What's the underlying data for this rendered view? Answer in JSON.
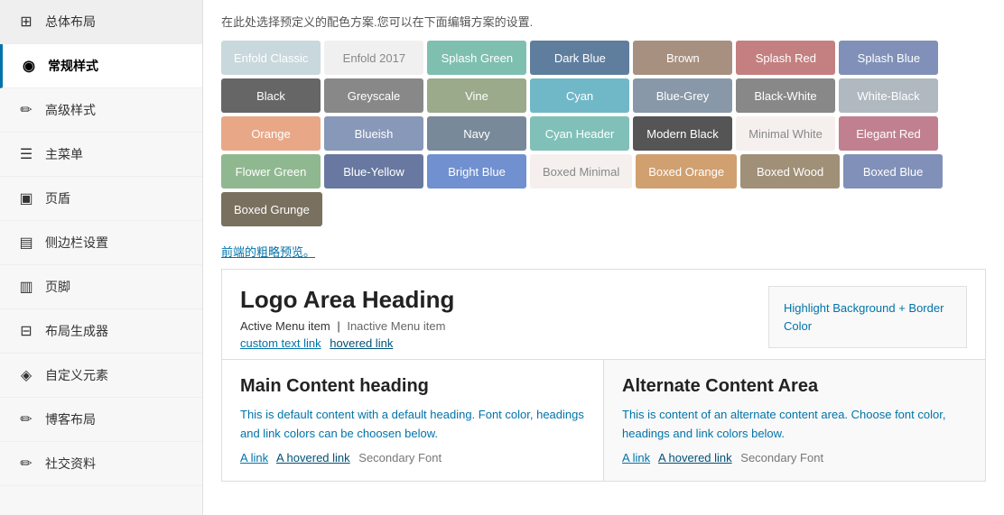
{
  "sidebar": {
    "items": [
      {
        "id": "general-layout",
        "label": "总体布局",
        "icon": "⊞",
        "active": false
      },
      {
        "id": "general-style",
        "label": "常规样式",
        "icon": "☺",
        "active": true
      },
      {
        "id": "advanced-style",
        "label": "高级样式",
        "icon": "✎",
        "active": false
      },
      {
        "id": "main-menu",
        "label": "主菜单",
        "icon": "☰",
        "active": false
      },
      {
        "id": "page-header",
        "label": "页盾",
        "icon": "▭",
        "active": false
      },
      {
        "id": "sidebar-settings",
        "label": "侧边栏设置",
        "icon": "▯",
        "active": false
      },
      {
        "id": "footer",
        "label": "页脚",
        "icon": "▭",
        "active": false
      },
      {
        "id": "layout-builder",
        "label": "布局生成器",
        "icon": "⊞",
        "active": false
      },
      {
        "id": "custom-elements",
        "label": "自定义元素",
        "icon": "✎",
        "active": false
      },
      {
        "id": "blog-layout",
        "label": "博客布局",
        "icon": "✎",
        "active": false
      },
      {
        "id": "contrib",
        "label": "社交资料",
        "icon": "☺",
        "active": false
      }
    ]
  },
  "main": {
    "instruction": "在此处选择预定义的配色方案.您可以在下面编辑方案的设置.",
    "color_schemes": [
      {
        "id": "enfold-classic",
        "label": "Enfold Classic",
        "bg": "#c9d8dd",
        "color": "#fff"
      },
      {
        "id": "enfold-2017",
        "label": "Enfold 2017",
        "bg": "#f0f0f0",
        "color": "#888"
      },
      {
        "id": "splash-green",
        "label": "Splash Green",
        "bg": "#7fbfb0",
        "color": "#fff"
      },
      {
        "id": "dark-blue",
        "label": "Dark Blue",
        "bg": "#5f7e9e",
        "color": "#fff"
      },
      {
        "id": "brown",
        "label": "Brown",
        "bg": "#a89080",
        "color": "#fff"
      },
      {
        "id": "splash-red",
        "label": "Splash Red",
        "bg": "#c48080",
        "color": "#fff"
      },
      {
        "id": "splash-blue",
        "label": "Splash Blue",
        "bg": "#8090b8",
        "color": "#fff"
      },
      {
        "id": "black",
        "label": "Black",
        "bg": "#666",
        "color": "#fff"
      },
      {
        "id": "greyscale",
        "label": "Greyscale",
        "bg": "#888",
        "color": "#fff"
      },
      {
        "id": "vine",
        "label": "Vine",
        "bg": "#9aaa8a",
        "color": "#fff"
      },
      {
        "id": "cyan",
        "label": "Cyan",
        "bg": "#70b8c8",
        "color": "#fff"
      },
      {
        "id": "blue-grey",
        "label": "Blue-Grey",
        "bg": "#8898a8",
        "color": "#fff"
      },
      {
        "id": "black-white",
        "label": "Black-White",
        "bg": "#888",
        "color": "#fff"
      },
      {
        "id": "white-black",
        "label": "White-Black",
        "bg": "#b0b8c0",
        "color": "#fff"
      },
      {
        "id": "orange",
        "label": "Orange",
        "bg": "#e8a888",
        "color": "#fff"
      },
      {
        "id": "blueish",
        "label": "Blueish",
        "bg": "#8898b8",
        "color": "#fff"
      },
      {
        "id": "navy",
        "label": "Navy",
        "bg": "#78899a",
        "color": "#fff"
      },
      {
        "id": "cyan-header",
        "label": "Cyan Header",
        "bg": "#80c0b8",
        "color": "#fff"
      },
      {
        "id": "modern-black",
        "label": "Modern Black",
        "bg": "#555",
        "color": "#fff"
      },
      {
        "id": "minimal-white",
        "label": "Minimal White",
        "bg": "#f5f0ee",
        "color": "#888"
      },
      {
        "id": "elegant-red",
        "label": "Elegant Red",
        "bg": "#c08090",
        "color": "#fff"
      },
      {
        "id": "flower-green",
        "label": "Flower Green",
        "bg": "#90b890",
        "color": "#fff"
      },
      {
        "id": "blue-yellow",
        "label": "Blue-Yellow",
        "bg": "#6878a0",
        "color": "#fff"
      },
      {
        "id": "bright-blue",
        "label": "Bright Blue",
        "bg": "#7090d0",
        "color": "#fff"
      },
      {
        "id": "boxed-minimal",
        "label": "Boxed Minimal",
        "bg": "#f5f0ee",
        "color": "#aaa"
      },
      {
        "id": "boxed-orange",
        "label": "Boxed Orange",
        "bg": "#d0a070",
        "color": "#fff"
      },
      {
        "id": "boxed-wood",
        "label": "Boxed Wood",
        "bg": "#a09078",
        "color": "#fff"
      },
      {
        "id": "boxed-blue",
        "label": "Boxed Blue",
        "bg": "#8090b8",
        "color": "#fff"
      },
      {
        "id": "boxed-grunge",
        "label": "Boxed Grunge",
        "bg": "#7a7060",
        "color": "#fff"
      }
    ],
    "preview_label": "前端的粗略预览。",
    "preview": {
      "logo_heading": "Logo Area Heading",
      "menu_active": "Active Menu item",
      "menu_separator": "|",
      "menu_inactive": "Inactive Menu item",
      "link_custom": "custom text link",
      "link_hovered": "hovered link",
      "highlight_text": "Highlight Background + Border Color",
      "main_heading": "Main Content heading",
      "main_text": "This is default content with a default heading. Font color, headings and link colors can be choosen below.",
      "main_link": "A link",
      "main_hovered_link": "A hovered link",
      "main_secondary_font": "Secondary Font",
      "alt_heading": "Alternate Content Area",
      "alt_text": "This is content of an alternate content area. Choose font color, headings and link colors below.",
      "alt_link": "A link",
      "alt_hovered_link": "A hovered link",
      "alt_secondary_font": "Secondary Font"
    }
  }
}
